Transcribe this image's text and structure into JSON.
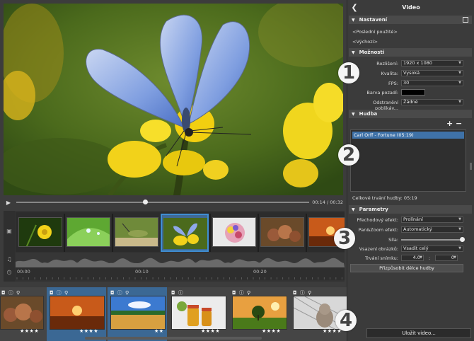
{
  "panel": {
    "title": "Video",
    "sections": {
      "settings": "Nastavení",
      "options": "Možnosti",
      "music": "Hudba",
      "params": "Parametry"
    },
    "settings_links": [
      "<Poslední použité>",
      "<Výchozí>"
    ],
    "options": {
      "resolution_label": "Rozlišení:",
      "resolution_value": "1920 x 1080",
      "quality_label": "Kvalita:",
      "quality_value": "Vysoká",
      "fps_label": "FPS:",
      "fps_value": "30",
      "bg_label": "Barva pozadí:",
      "bg_color": "#000000",
      "flicker_label": "Odstranění poblikáv...",
      "flicker_value": "Žádné"
    },
    "music": {
      "add": "+",
      "remove": "−",
      "items": [
        "Carl Orff - Fortune (05:19)"
      ],
      "total": "Celkové trvání hudby: 05:19"
    },
    "params": {
      "transition_label": "Přechodový efekt:",
      "transition_value": "Prolínání",
      "panzoom_label": "Pan&Zoom efekt:",
      "panzoom_value": "Automatický",
      "strength_label": "Síla:",
      "strength_value": 1.0,
      "fit_label": "Vsazení obrázků:",
      "fit_value": "Vsadit celý",
      "duration_label": "Trvání snímku:",
      "duration_sec": "4.0",
      "duration_sep": ":",
      "duration_frames": "0",
      "fit_music_button": "Přizpůsobit délce hudby"
    },
    "save_button": "Uložit video..."
  },
  "player": {
    "time": "00:14 / 00:32",
    "progress": 0.44
  },
  "timeline": {
    "ticks": [
      "00:00",
      "00:10",
      "00:20"
    ]
  },
  "gallery": {
    "items": [
      {
        "icons": "◘ ⓘ ⚲",
        "stars": "★★★★"
      },
      {
        "icons": "◘ ⓘ ⚲",
        "stars": "★★★★"
      },
      {
        "icons": "◘ ⓘ ⚲",
        "stars": "★★"
      },
      {
        "icons": "◘ ⓘ",
        "stars": "★★★★"
      },
      {
        "icons": "◘ ⓘ ⚲",
        "stars": "★★★★"
      },
      {
        "icons": "◘ ⓘ ⚲",
        "stars": "★★★★"
      }
    ]
  },
  "badges": [
    "1",
    "2",
    "3",
    "4"
  ],
  "colors": {
    "accent": "#3f8ed3",
    "selection": "#3f72a8"
  }
}
